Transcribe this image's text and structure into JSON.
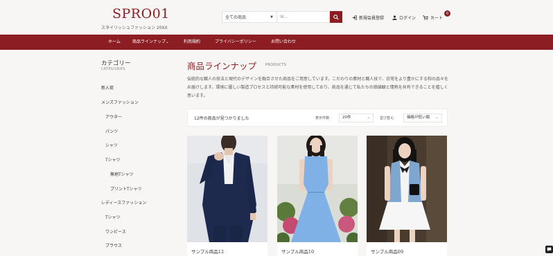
{
  "header": {
    "logo": "SPRO01",
    "tagline": "スタイリッシュファッション 20XX",
    "search": {
      "category": "全ての商品",
      "placeholder": "W..."
    },
    "links": {
      "register": "新規会員登録",
      "login": "ログイン",
      "cart": "カート",
      "cart_count": "0"
    }
  },
  "nav": [
    "ホーム",
    "商品ラインナップ⌄",
    "利用規約",
    "プライバシーポリシー",
    "お問い合わせ"
  ],
  "sidebar": {
    "title": "カテゴリー",
    "subtitle": "CATEGORIES",
    "items": [
      "新入荷",
      "メンズファッション",
      "アウター",
      "パンツ",
      "シャツ",
      "Tシャツ",
      "無地Tシャツ",
      "プリントTシャツ",
      "レディースファッション",
      "Tシャツ",
      "ワンピース",
      "ブラウス"
    ]
  },
  "main": {
    "title": "商品ラインナップ",
    "subtitle": "PRODUCTS",
    "intro": "伝統的な職人の技法と現代のデザインを融合させた商品をご用意しています。こだわりの素材と職人技で、日常をより豊かにする和の品々をお届けします。環境に優しい製造プロセスと持続可能な素材を使用しており、商品を通じて私たちの価値観と情熱を共有できることを嬉しく思います。",
    "toolbar": {
      "count": "12件の商品が見つかりました",
      "per_page_label": "表示件数:",
      "per_page_value": "20件",
      "sort_label": "並び替え:",
      "sort_value": "価格が低い順"
    },
    "products": [
      {
        "name": "サンプル商品12"
      },
      {
        "name": "サンプル商品10"
      },
      {
        "name": "サンプル商品09"
      }
    ]
  }
}
